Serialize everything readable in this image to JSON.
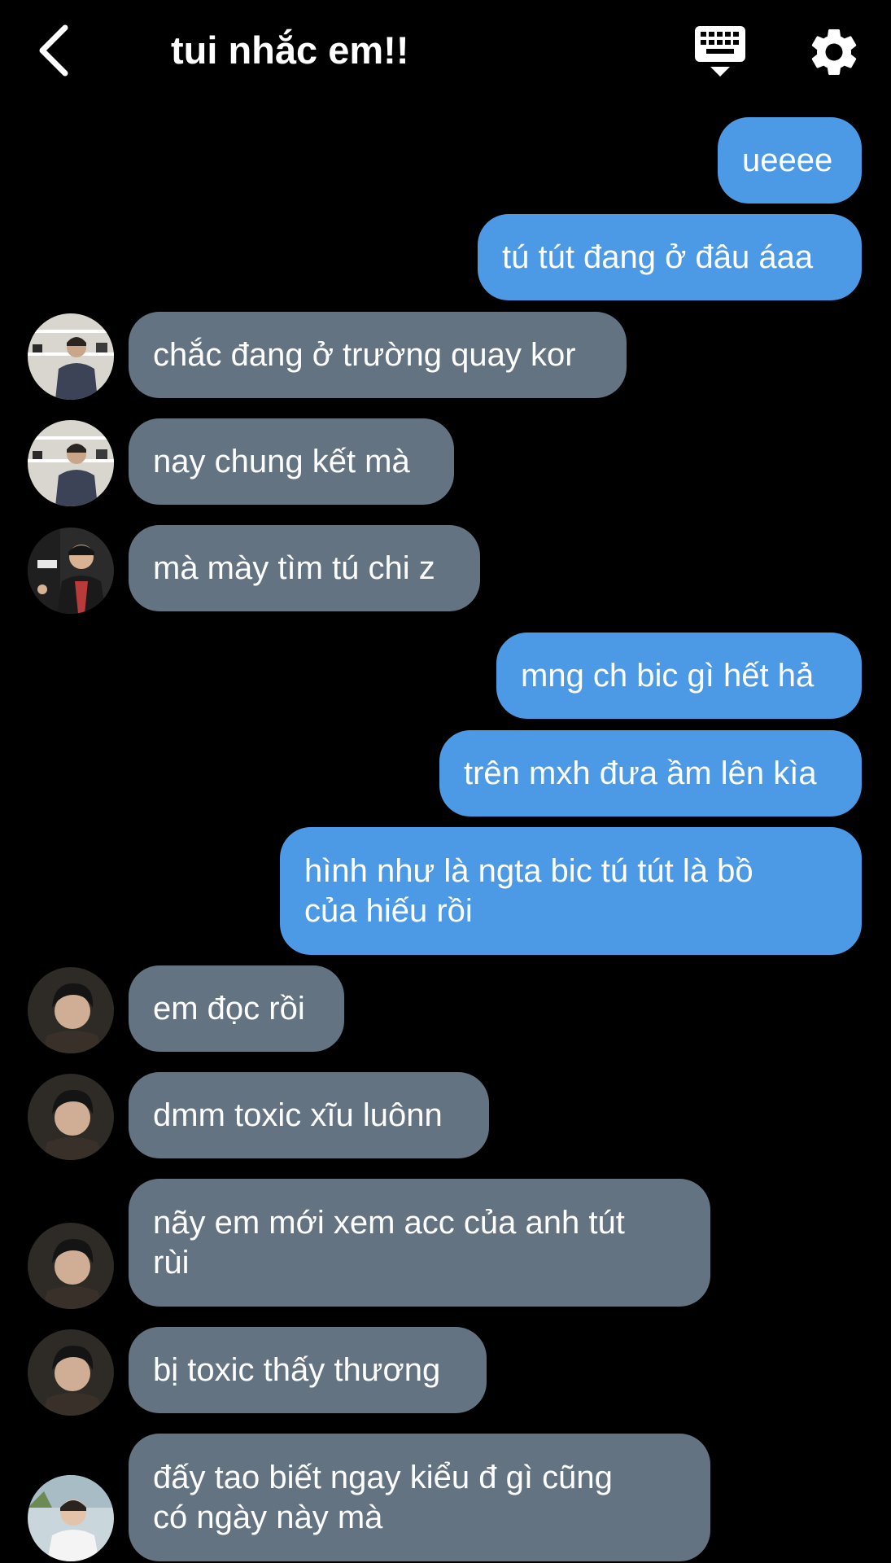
{
  "header": {
    "title": "tui nhắc em!!",
    "back_icon": "chevron-left-icon",
    "keyboard_icon": "keyboard-icon",
    "settings_icon": "gear-icon"
  },
  "colors": {
    "background": "#000000",
    "outgoing_bubble": "#4c9ae6",
    "incoming_bubble": "#637381",
    "text": "#ffffff"
  },
  "messages": [
    {
      "side": "out",
      "text": "ueeee"
    },
    {
      "side": "out",
      "text": "tú tút đang ở đâu áaa"
    },
    {
      "side": "in",
      "avatar": "avatar-a",
      "text": "chắc đang ở trường quay kor"
    },
    {
      "side": "in",
      "avatar": "avatar-a",
      "text": "nay chung kết mà"
    },
    {
      "side": "in",
      "avatar": "avatar-b",
      "text": "mà mày tìm tú chi z"
    },
    {
      "side": "out",
      "text": "mng ch bic gì hết hả"
    },
    {
      "side": "out",
      "text": "trên mxh đưa ầm lên kìa"
    },
    {
      "side": "out",
      "text_lines": [
        "hình như là ngta bic tú tút là bồ",
        "của hiếu rồi"
      ]
    },
    {
      "side": "in",
      "avatar": "avatar-c",
      "text": "em đọc rồi"
    },
    {
      "side": "in",
      "avatar": "avatar-c",
      "text": "dmm toxic xĩu luônn"
    },
    {
      "side": "in",
      "avatar": "avatar-c",
      "text_lines": [
        "nãy em mới xem acc của anh tút",
        "rùi"
      ]
    },
    {
      "side": "in",
      "avatar": "avatar-c",
      "text": "bị toxic thấy thương"
    },
    {
      "side": "in",
      "avatar": "avatar-d",
      "text_lines": [
        "đấy tao biết ngay kiểu đ gì cũng",
        "có ngày này mà"
      ]
    }
  ]
}
